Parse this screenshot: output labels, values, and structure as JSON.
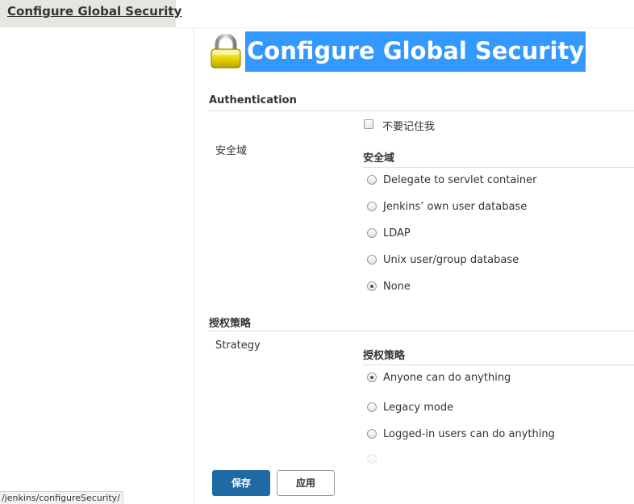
{
  "breadcrumb": {
    "label": "Configure Global Security"
  },
  "page": {
    "title": "Configure Global Security",
    "title_highlight_color": "#3399ff"
  },
  "authentication": {
    "header": "Authentication",
    "remember_me_label": "不要记住我",
    "remember_me_checked": false,
    "realm_row_label": "安全域",
    "realm_subheader": "安全域",
    "realm_options": [
      {
        "label": "Delegate to servlet container",
        "checked": false
      },
      {
        "label": "Jenkins’ own user database",
        "checked": false
      },
      {
        "label": "LDAP",
        "checked": false
      },
      {
        "label": "Unix user/group database",
        "checked": false
      },
      {
        "label": "None",
        "checked": true
      }
    ]
  },
  "authorization": {
    "header": "授权策略",
    "strategy_row_label": "Strategy",
    "strategy_subheader": "授权策略",
    "strategy_options": [
      {
        "label": "Anyone can do anything",
        "checked": true
      },
      {
        "label": "Legacy mode",
        "checked": false
      },
      {
        "label": "Logged-in users can do anything",
        "checked": false
      }
    ]
  },
  "buttons": {
    "save_label": "保存",
    "apply_label": "应用",
    "save_color": "#1d6aa5"
  },
  "status_bar": {
    "url": "/jenkins/configureSecurity/"
  },
  "icons": {
    "page_icon": "lock-icon"
  }
}
